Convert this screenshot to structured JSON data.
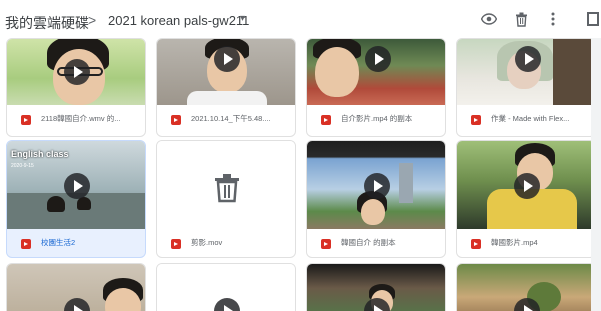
{
  "breadcrumb": {
    "root": "我的雲端硬碟",
    "separator": ">",
    "current": "2021 korean pals-gw211",
    "caret": "▾"
  },
  "toolbar": {
    "preview_icon": "eye-icon",
    "delete_icon": "trash-icon",
    "more_icon": "more-vert-icon",
    "details_icon": "details-panel-icon"
  },
  "files": [
    {
      "name": "2118韓國自介.wmv 的...",
      "selected": false
    },
    {
      "name": "2021.10.14_下午5.48....",
      "selected": false
    },
    {
      "name": "自介影片.mp4 的副本",
      "selected": false
    },
    {
      "name": "作業 - Made with Flex...",
      "selected": false
    },
    {
      "name": "校園生活2",
      "selected": true,
      "overlay": "English class",
      "overlay_sub": "2020-9-15"
    },
    {
      "name": "剪影.mov",
      "selected": false
    },
    {
      "name": "韓國自介 的副本",
      "selected": false
    },
    {
      "name": "韓國影片.mp4",
      "selected": false
    },
    {
      "name": "",
      "selected": false
    },
    {
      "name": "",
      "selected": false
    },
    {
      "name": "",
      "selected": false
    },
    {
      "name": "",
      "selected": false
    }
  ],
  "colors": {
    "file_icon": "#d93025",
    "selected_bg": "#e8f0fe",
    "selected_text": "#1967d2"
  }
}
